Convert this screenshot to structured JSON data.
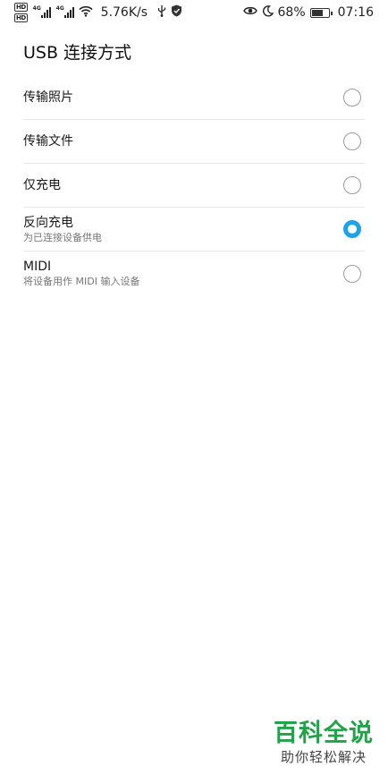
{
  "status_bar": {
    "hd1": "HD",
    "hd2": "HD",
    "net1": "4G",
    "net2": "4G",
    "speed": "5.76K/s",
    "battery_pct": "68%",
    "battery_level": 0.68,
    "time": "07:16",
    "icons": [
      "hd-icon",
      "signal-4g-icon",
      "signal-4g-icon",
      "wifi-icon",
      "usb-icon",
      "shield-icon",
      "eye-icon",
      "moon-icon",
      "battery-icon"
    ]
  },
  "page": {
    "title": "USB 连接方式"
  },
  "options": [
    {
      "label": "传输照片",
      "sub": "",
      "selected": false
    },
    {
      "label": "传输文件",
      "sub": "",
      "selected": false
    },
    {
      "label": "仅充电",
      "sub": "",
      "selected": false
    },
    {
      "label": "反向充电",
      "sub": "为已连接设备供电",
      "selected": true
    },
    {
      "label": "MIDI",
      "sub": "将设备用作 MIDI 输入设备",
      "selected": false
    }
  ],
  "watermark": {
    "title": "百科全说",
    "sub": "助你轻松解决"
  },
  "colors": {
    "accent": "#1fa3e8",
    "watermark": "#22a34a"
  }
}
